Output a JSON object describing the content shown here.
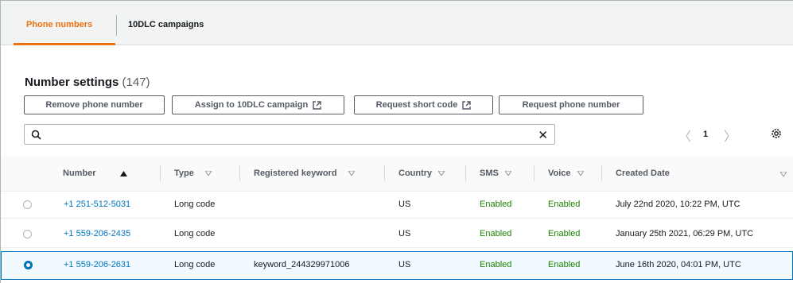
{
  "tabs": [
    {
      "label": "Phone numbers",
      "active": true
    },
    {
      "label": "10DLC campaigns",
      "active": false
    }
  ],
  "header": {
    "title": "Number settings",
    "count": "(147)"
  },
  "actions": {
    "remove": "Remove phone number",
    "assign": "Assign to 10DLC campaign",
    "short_code": "Request short code",
    "request": "Request phone number"
  },
  "search": {
    "value": "",
    "placeholder": ""
  },
  "pagination": {
    "page": "1"
  },
  "table": {
    "columns": [
      "Number",
      "Type",
      "Registered keyword",
      "Country",
      "SMS",
      "Voice",
      "Created Date"
    ],
    "rows": [
      {
        "selected": false,
        "number": "+1 251-512-5031",
        "type": "Long code",
        "keyword": "",
        "country": "US",
        "sms": "Enabled",
        "voice": "Enabled",
        "created": "July 22nd 2020, 10:22 PM, UTC"
      },
      {
        "selected": false,
        "number": "+1 559-206-2435",
        "type": "Long code",
        "keyword": "",
        "country": "US",
        "sms": "Enabled",
        "voice": "Enabled",
        "created": "January 25th 2021, 06:29 PM, UTC"
      },
      {
        "selected": true,
        "number": "+1 559-206-2631",
        "type": "Long code",
        "keyword": "keyword_244329971006",
        "country": "US",
        "sms": "Enabled",
        "voice": "Enabled",
        "created": "June 16th 2020, 04:01 PM, UTC"
      }
    ]
  },
  "colors": {
    "accent": "#ec7211",
    "link": "#0073bb",
    "enabled": "#1d8102"
  },
  "icons": {
    "search": "search-icon",
    "clear": "close-icon",
    "external": "external-link-icon",
    "settings": "gear-icon",
    "prev": "chevron-left-icon",
    "next": "chevron-right-icon"
  }
}
